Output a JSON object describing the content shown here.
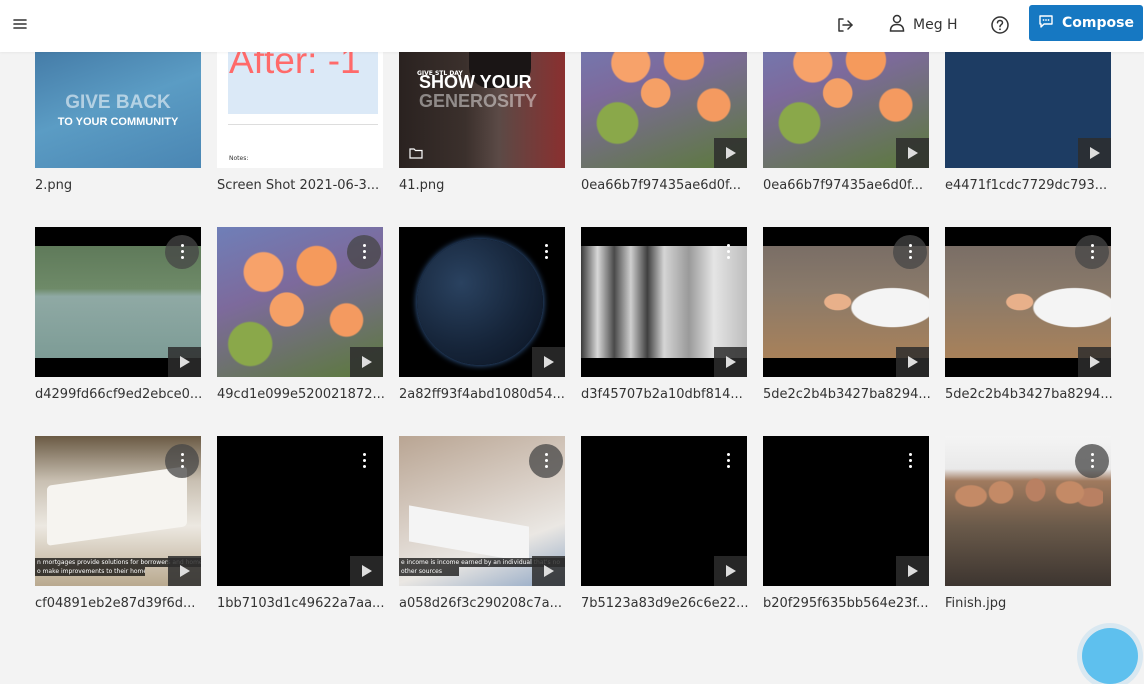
{
  "header": {
    "menu_icon": "hamburger-icon",
    "logout_icon": "logout-icon",
    "user_icon": "user-icon",
    "user_name": "Meg H",
    "help_icon": "help-circle-icon",
    "compose_icon": "chat-bubble-icon",
    "compose_label": "Compose",
    "accent_color": "#1678c2"
  },
  "grid": {
    "items": [
      {
        "filename": "2.png",
        "kind": "image"
      },
      {
        "filename": "Screen Shot 2021-06-3...",
        "kind": "image"
      },
      {
        "filename": "41.png",
        "kind": "image"
      },
      {
        "filename": "0ea66b7f97435ae6d0f...",
        "kind": "video"
      },
      {
        "filename": "0ea66b7f97435ae6d0f...",
        "kind": "video"
      },
      {
        "filename": "e4471f1cdc7729dc793...",
        "kind": "video"
      },
      {
        "filename": "d4299fd66cf9ed2ebce0...",
        "kind": "video"
      },
      {
        "filename": "49cd1e099e520021872...",
        "kind": "video"
      },
      {
        "filename": "2a82ff93f4abd1080d54...",
        "kind": "video"
      },
      {
        "filename": "d3f45707b2a10dbf814...",
        "kind": "video"
      },
      {
        "filename": "5de2c2b4b3427ba8294...",
        "kind": "video"
      },
      {
        "filename": "5de2c2b4b3427ba8294...",
        "kind": "video"
      },
      {
        "filename": "cf04891eb2e87d39f6d...",
        "kind": "video"
      },
      {
        "filename": "1bb7103d1c49622a7aa...",
        "kind": "video"
      },
      {
        "filename": "a058d26f3c290208c7a...",
        "kind": "video"
      },
      {
        "filename": "7b5123a83d9e26c6e22...",
        "kind": "video"
      },
      {
        "filename": "b20f295f635bb564e23f...",
        "kind": "video"
      },
      {
        "filename": "Finish.jpg",
        "kind": "image"
      }
    ]
  },
  "thumb_text": {
    "give_back_line1": "GIVE BACK",
    "give_back_line2": "TO YOUR COMMUNITY",
    "after_text": "After: -1",
    "notes_label": "Notes:",
    "show_line1": "SHOW YOUR",
    "show_line2": "GENEROSITY",
    "give_small": "GIVE STL DAY",
    "mortgage_line1": "n mortgages provide solutions for borrowers and homeo",
    "mortgage_line2": "o make improvements to their home",
    "income_line1": "e income is income earned by an individual that's no",
    "income_line2": "other sources"
  },
  "fab_icon": "chat-fab-icon"
}
